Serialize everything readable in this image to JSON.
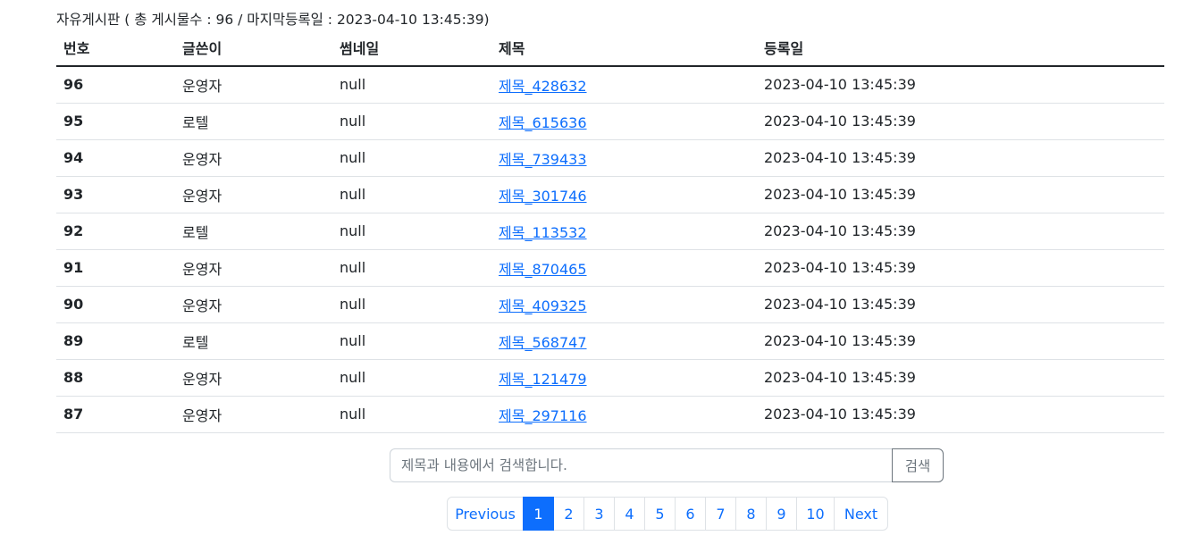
{
  "board": {
    "caption": "자유게시판 ( 총 게시물수 : 96 / 마지막등록일 : 2023-04-10 13:45:39)",
    "columns": [
      "번호",
      "글쓴이",
      "썸네일",
      "제목",
      "등록일"
    ],
    "rows": [
      {
        "no": "96",
        "writer": "운영자",
        "thumb": "null",
        "title": "제목_428632",
        "date": "2023-04-10 13:45:39"
      },
      {
        "no": "95",
        "writer": "로텔",
        "thumb": "null",
        "title": "제목_615636",
        "date": "2023-04-10 13:45:39"
      },
      {
        "no": "94",
        "writer": "운영자",
        "thumb": "null",
        "title": "제목_739433",
        "date": "2023-04-10 13:45:39"
      },
      {
        "no": "93",
        "writer": "운영자",
        "thumb": "null",
        "title": "제목_301746",
        "date": "2023-04-10 13:45:39"
      },
      {
        "no": "92",
        "writer": "로텔",
        "thumb": "null",
        "title": "제목_113532",
        "date": "2023-04-10 13:45:39"
      },
      {
        "no": "91",
        "writer": "운영자",
        "thumb": "null",
        "title": "제목_870465",
        "date": "2023-04-10 13:45:39"
      },
      {
        "no": "90",
        "writer": "운영자",
        "thumb": "null",
        "title": "제목_409325",
        "date": "2023-04-10 13:45:39"
      },
      {
        "no": "89",
        "writer": "로텔",
        "thumb": "null",
        "title": "제목_568747",
        "date": "2023-04-10 13:45:39"
      },
      {
        "no": "88",
        "writer": "운영자",
        "thumb": "null",
        "title": "제목_121479",
        "date": "2023-04-10 13:45:39"
      },
      {
        "no": "87",
        "writer": "운영자",
        "thumb": "null",
        "title": "제목_297116",
        "date": "2023-04-10 13:45:39"
      }
    ]
  },
  "search": {
    "placeholder": "제목과 내용에서 검색합니다.",
    "value": "",
    "button_label": "검색"
  },
  "pagination": {
    "previous_label": "Previous",
    "next_label": "Next",
    "pages": [
      "1",
      "2",
      "3",
      "4",
      "5",
      "6",
      "7",
      "8",
      "9",
      "10"
    ],
    "current_page": "1"
  },
  "colors": {
    "accent": "#0d6efd",
    "text": "#212529",
    "border": "#dee2e6",
    "secondary": "#6c757d"
  }
}
